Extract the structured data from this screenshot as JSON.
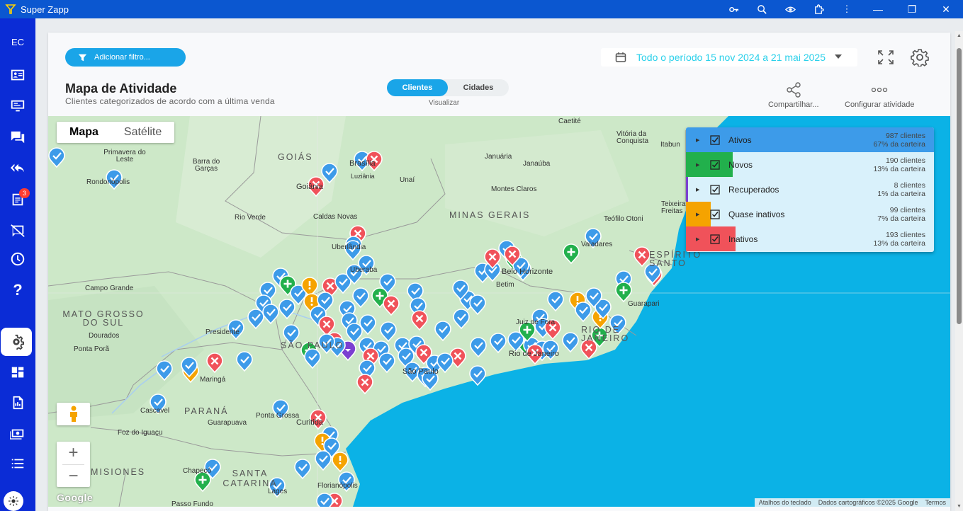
{
  "window": {
    "title": "Super Zapp"
  },
  "sidebar": {
    "initials": "EC",
    "badge_count": "3",
    "items": [
      {
        "name": "contact-card-icon"
      },
      {
        "name": "monitor-icon"
      },
      {
        "name": "chat-icon"
      },
      {
        "name": "reply-all-icon"
      },
      {
        "name": "reports-icon"
      },
      {
        "name": "comment-off-icon"
      },
      {
        "name": "clock-icon"
      },
      {
        "name": "help-icon"
      },
      {
        "name": "settings-icon"
      },
      {
        "name": "dashboard-icon"
      },
      {
        "name": "document-chart-icon"
      },
      {
        "name": "money-icon"
      },
      {
        "name": "list-icon"
      }
    ]
  },
  "toolbar": {
    "filter_label": "Adicionar filtro...",
    "date_range": "Todo o período 15 nov 2024 a 21 mai 2025"
  },
  "header": {
    "title": "Mapa de Atividade",
    "subtitle": "Clientes categorizados de acordo com a última venda",
    "toggle": {
      "options": [
        "Clientes",
        "Cidades"
      ],
      "caption": "Visualizar"
    },
    "share_label": "Compartilhar...",
    "configure_label": "Configurar atividade"
  },
  "map": {
    "type_options": [
      "Mapa",
      "Satélite"
    ],
    "attribution": [
      "Atalhos do teclado",
      "Dados cartográficos ©2025 Google",
      "Termos"
    ],
    "google_logo": "Google",
    "labels": [
      {
        "text": "Caetité"
      },
      {
        "text": "Vitória da Conquista"
      },
      {
        "text": "Itabun"
      },
      {
        "text": "Primavera do Leste"
      },
      {
        "text": "Barra do Garças"
      },
      {
        "text": "GOIÁS"
      },
      {
        "text": "Brasília"
      },
      {
        "text": "Luziânia"
      },
      {
        "text": "Unaí"
      },
      {
        "text": "Januária"
      },
      {
        "text": "Janaúba"
      },
      {
        "text": "Rondonópolis"
      },
      {
        "text": "Goiânia"
      },
      {
        "text": "Montes Claros"
      },
      {
        "text": "Teixeira de Freitas"
      },
      {
        "text": "Rio Verde"
      },
      {
        "text": "Caldas Novas"
      },
      {
        "text": "MINAS GERAIS"
      },
      {
        "text": "Teófilo Otoni"
      },
      {
        "text": "Uberlândia"
      },
      {
        "text": "Valadares"
      },
      {
        "text": "ESPÍRITO SANTO"
      },
      {
        "text": "Uberaba"
      },
      {
        "text": "Belo Horizonte"
      },
      {
        "text": "Betim"
      },
      {
        "text": "Campo Grande"
      },
      {
        "text": "Guarapari"
      },
      {
        "text": "MATO GROSSO DO SUL"
      },
      {
        "text": "Presidente"
      },
      {
        "text": "Juiz de Fora"
      },
      {
        "text": "Dourados"
      },
      {
        "text": "SÃO PAULO"
      },
      {
        "text": "RIO DE JANEIRO"
      },
      {
        "text": "Ponta Porã"
      },
      {
        "text": "Rio de Janeiro"
      },
      {
        "text": "Maringá"
      },
      {
        "text": "São Paulo"
      },
      {
        "text": "PARANÁ"
      },
      {
        "text": "Cascavel"
      },
      {
        "text": "Ponta Grossa"
      },
      {
        "text": "Guarapuava"
      },
      {
        "text": "Curitiba"
      },
      {
        "text": "Foz do Iguaçu"
      },
      {
        "text": "MISIONES"
      },
      {
        "text": "Chapecó"
      },
      {
        "text": "SANTA CATARINA"
      },
      {
        "text": "Lages"
      },
      {
        "text": "Florianópolis"
      },
      {
        "text": "Passo Fundo"
      }
    ]
  },
  "legend": [
    {
      "label": "Ativos",
      "count": "987 clientes",
      "share": "67% da carteira",
      "color": "#3d9be9"
    },
    {
      "label": "Novos",
      "count": "190 clientes",
      "share": "13% da carteira",
      "color": "#22b04c"
    },
    {
      "label": "Recuperados",
      "count": "8 clientes",
      "share": "1% da carteira",
      "color": "#7b3fd1"
    },
    {
      "label": "Quase inativos",
      "count": "99 clientes",
      "share": "7% da carteira",
      "color": "#f5a300"
    },
    {
      "label": "Inativos",
      "count": "193 clientes",
      "share": "13% da carteira",
      "color": "#f0525a"
    }
  ]
}
